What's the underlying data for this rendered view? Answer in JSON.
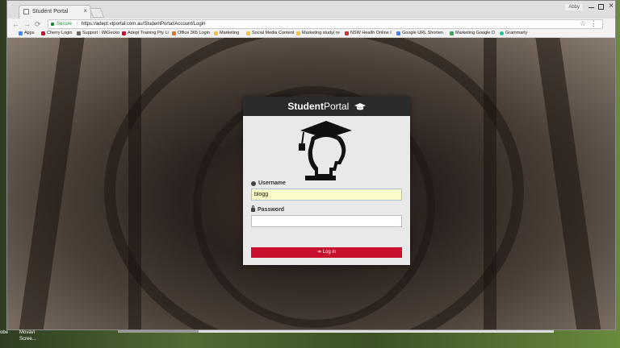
{
  "browser": {
    "tab_title": "Student Portal",
    "tab_close": "×",
    "profile_chip": "Abby",
    "nav_back": "←",
    "nav_forward": "→",
    "nav_reload": "⟳",
    "secure_label": "Secure",
    "separator": "|",
    "url": "https://adept.vtportal.com.au/StudentPortal/Account/Login",
    "star": "☆",
    "menu": "⋮"
  },
  "bookmarks": [
    {
      "label": "Apps",
      "icon": "apps-icon",
      "color": "#4285f4"
    },
    {
      "label": "Cherry Login",
      "icon": "cherry-icon",
      "color": "#c8102e"
    },
    {
      "label": "Support : WiGecko",
      "icon": "support-icon",
      "color": "#666666"
    },
    {
      "label": "Adept Training Pty Li",
      "icon": "adept-icon",
      "color": "#c8102e"
    },
    {
      "label": "Office 365 Login",
      "icon": "office-icon",
      "color": "#e3741f"
    },
    {
      "label": "Marketing",
      "icon": "folder-icon",
      "color": "#f3c34b"
    },
    {
      "label": "Social Media Content",
      "icon": "folder-icon",
      "color": "#f3c34b"
    },
    {
      "label": "Marketing study/ re",
      "icon": "folder-icon",
      "color": "#f3c34b"
    },
    {
      "label": "NSW Health Online I",
      "icon": "nsw-icon",
      "color": "#d32f2f"
    },
    {
      "label": "Google URL Shorten",
      "icon": "google-icon",
      "color": "#4285f4"
    },
    {
      "label": "Marketing Google D",
      "icon": "drive-icon",
      "color": "#34a853"
    },
    {
      "label": "Grammarly",
      "icon": "grammarly-icon",
      "color": "#15c39a"
    }
  ],
  "login": {
    "brand_bold": "Student",
    "brand_light": "Portal",
    "username_label": "Username",
    "username_value": "blogg",
    "password_label": "Password",
    "password_value": "",
    "login_button": "Log in"
  },
  "desktop": {
    "icon_labels": [
      "obe",
      "Movavi",
      "Scree..."
    ]
  },
  "colors": {
    "brand_red": "#c8102e",
    "header_dark": "#2b2b2b",
    "autofill_yellow": "#fafbc8"
  }
}
